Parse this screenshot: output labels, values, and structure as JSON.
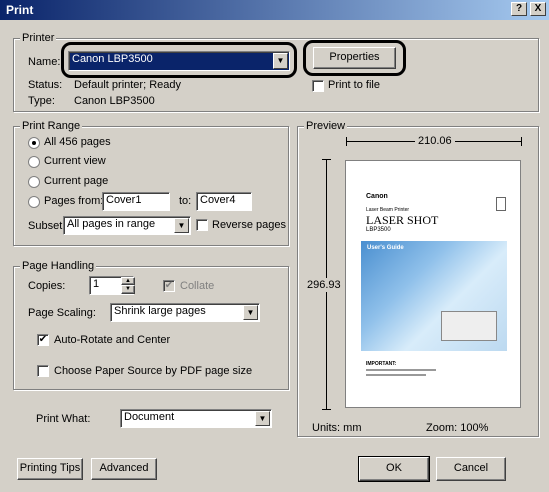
{
  "window": {
    "title": "Print",
    "help_label": "?",
    "close_label": "X"
  },
  "printer": {
    "group_label": "Printer",
    "name_label": "Name:",
    "name_value": "Canon LBP3500",
    "properties_label": "Properties",
    "status_label": "Status:",
    "status_value": "Default printer; Ready",
    "type_label": "Type:",
    "type_value": "Canon LBP3500",
    "print_to_file_label": "Print to file"
  },
  "print_range": {
    "group_label": "Print Range",
    "all_label": "All 456 pages",
    "current_view_label": "Current view",
    "current_page_label": "Current page",
    "pages_from_label": "Pages from:",
    "from_value": "Cover1",
    "to_label": "to:",
    "to_value": "Cover4",
    "subset_label": "Subset:",
    "subset_value": "All pages in range",
    "reverse_label": "Reverse pages"
  },
  "page_handling": {
    "group_label": "Page Handling",
    "copies_label": "Copies:",
    "copies_value": "1",
    "collate_label": "Collate",
    "scaling_label": "Page Scaling:",
    "scaling_value": "Shrink large pages",
    "auto_rotate_label": "Auto-Rotate and Center",
    "choose_paper_label": "Choose Paper Source by PDF page size"
  },
  "print_what": {
    "label": "Print What:",
    "value": "Document"
  },
  "preview": {
    "group_label": "Preview",
    "width_value": "210.06",
    "height_value": "296.93",
    "units_label": "Units: mm",
    "zoom_label": "Zoom: 100%",
    "page_brand": "Canon",
    "page_subtitle": "Laser Beam Printer",
    "page_title": "LASER SHOT",
    "page_model": "LBP3500",
    "page_section": "User's Guide",
    "page_note": "IMPORTANT:"
  },
  "footer": {
    "tips_label": "Printing Tips",
    "advanced_label": "Advanced",
    "ok_label": "OK",
    "cancel_label": "Cancel"
  }
}
